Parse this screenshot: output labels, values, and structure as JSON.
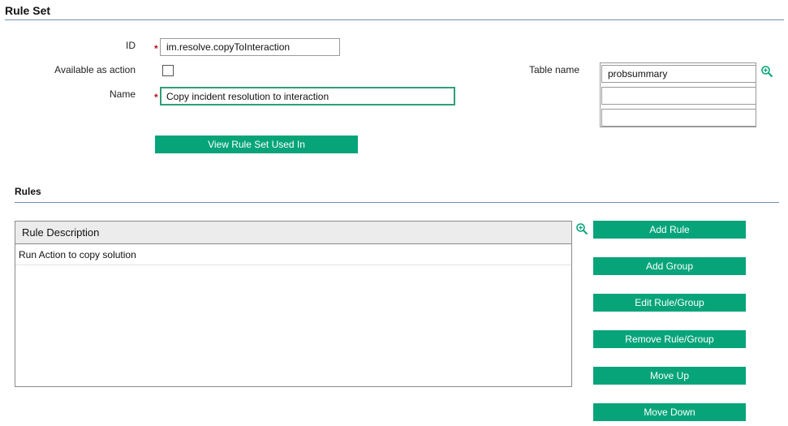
{
  "rule_set": {
    "section_title": "Rule Set",
    "id_label": "ID",
    "id_value": "im.resolve.copyToInteraction",
    "available_label": "Available as action",
    "name_label": "Name",
    "name_value": "Copy incident resolution to interaction",
    "table_name_label": "Table name",
    "table_names": [
      "probsummary",
      "",
      ""
    ],
    "view_button": "View Rule Set Used In"
  },
  "rules": {
    "section_title": "Rules",
    "column_header": "Rule Description",
    "rows": [
      "Run Action to copy solution"
    ],
    "buttons": {
      "add_rule": "Add Rule",
      "add_group": "Add Group",
      "edit": "Edit Rule/Group",
      "remove": "Remove Rule/Group",
      "move_up": "Move Up",
      "move_down": "Move Down"
    }
  },
  "required_marker": "*",
  "colors": {
    "accent": "#07a47a",
    "divider": "#6e8fb0",
    "required": "#b5121b"
  }
}
